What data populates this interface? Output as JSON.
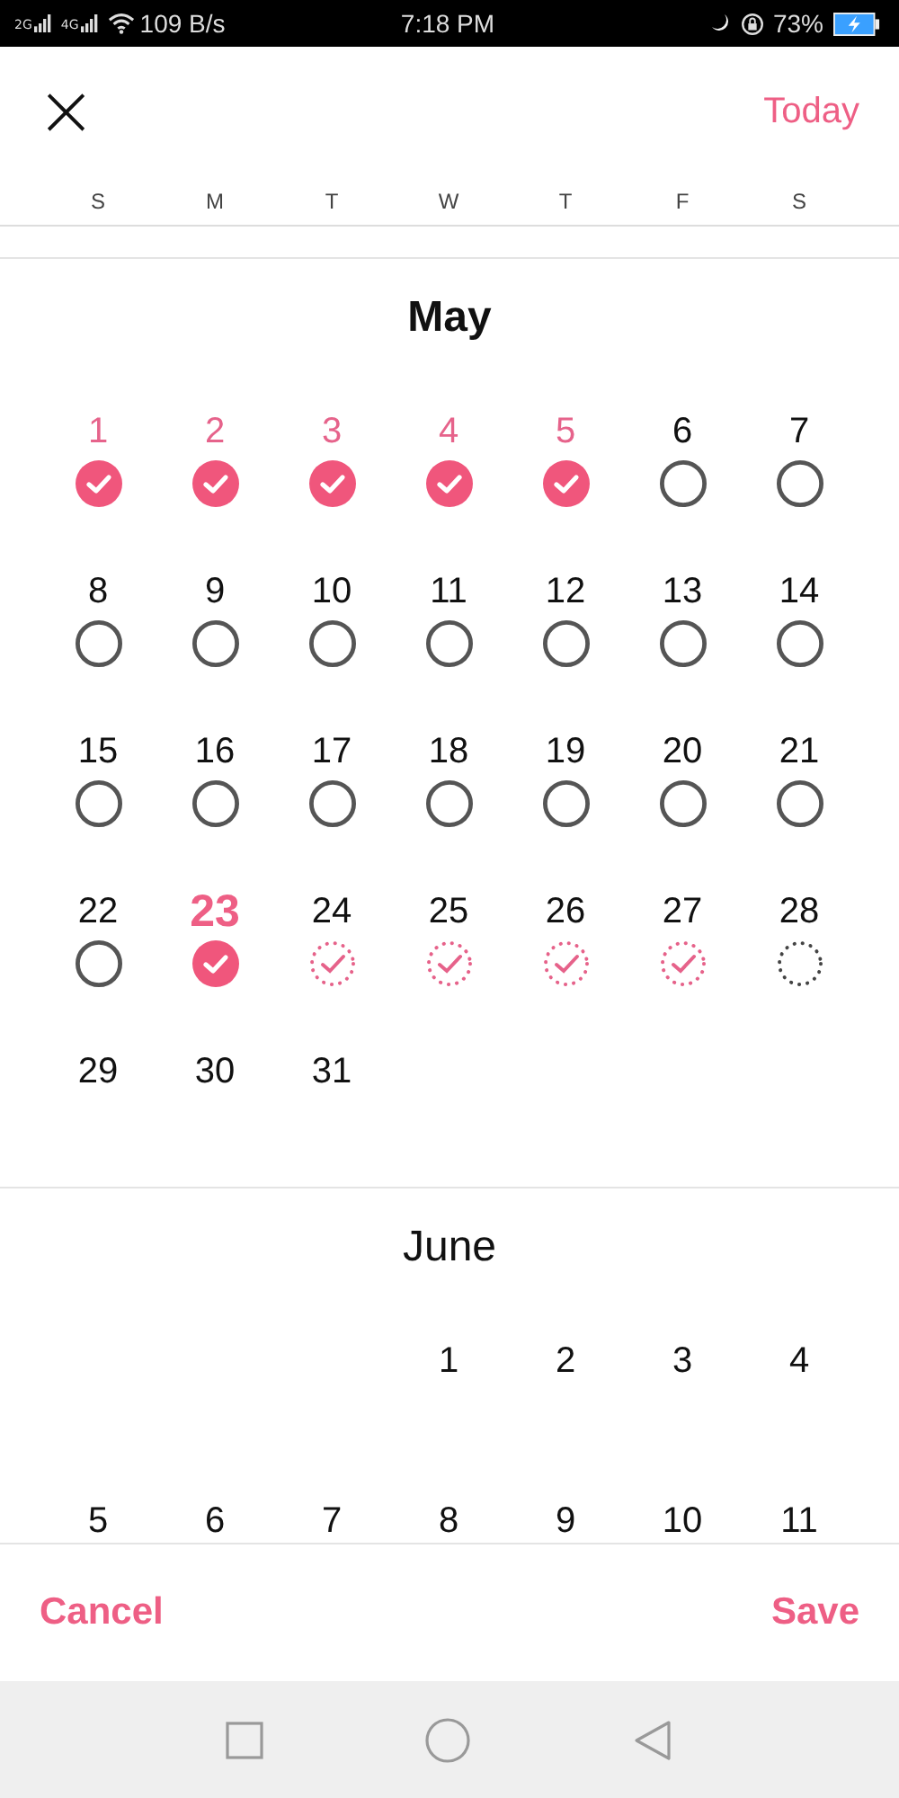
{
  "status_bar": {
    "network_1": "2G",
    "network_2": "4G",
    "speed": "109 B/s",
    "time": "7:18 PM",
    "battery": "73%"
  },
  "header": {
    "close": "×",
    "today": "Today"
  },
  "weekdays": [
    "S",
    "M",
    "T",
    "W",
    "T",
    "F",
    "S"
  ],
  "months": [
    {
      "title": "May",
      "bold": true,
      "days": [
        {
          "label": "1",
          "kind": "checked",
          "today": false
        },
        {
          "label": "2",
          "kind": "checked",
          "today": false
        },
        {
          "label": "3",
          "kind": "checked",
          "today": false
        },
        {
          "label": "4",
          "kind": "checked",
          "today": false
        },
        {
          "label": "5",
          "kind": "checked",
          "today": false
        },
        {
          "label": "6",
          "kind": "open",
          "today": false
        },
        {
          "label": "7",
          "kind": "open",
          "today": false
        },
        {
          "label": "8",
          "kind": "open",
          "today": false
        },
        {
          "label": "9",
          "kind": "open",
          "today": false
        },
        {
          "label": "10",
          "kind": "open",
          "today": false
        },
        {
          "label": "11",
          "kind": "open",
          "today": false
        },
        {
          "label": "12",
          "kind": "open",
          "today": false
        },
        {
          "label": "13",
          "kind": "open",
          "today": false
        },
        {
          "label": "14",
          "kind": "open",
          "today": false
        },
        {
          "label": "15",
          "kind": "open",
          "today": false
        },
        {
          "label": "16",
          "kind": "open",
          "today": false
        },
        {
          "label": "17",
          "kind": "open",
          "today": false
        },
        {
          "label": "18",
          "kind": "open",
          "today": false
        },
        {
          "label": "19",
          "kind": "open",
          "today": false
        },
        {
          "label": "20",
          "kind": "open",
          "today": false
        },
        {
          "label": "21",
          "kind": "open",
          "today": false
        },
        {
          "label": "22",
          "kind": "open",
          "today": false
        },
        {
          "label": "23",
          "kind": "checked",
          "today": true
        },
        {
          "label": "24",
          "kind": "planned",
          "today": false
        },
        {
          "label": "25",
          "kind": "planned",
          "today": false
        },
        {
          "label": "26",
          "kind": "planned",
          "today": false
        },
        {
          "label": "27",
          "kind": "planned",
          "today": false
        },
        {
          "label": "28",
          "kind": "dotted",
          "today": false
        },
        {
          "label": "29",
          "kind": "none",
          "today": false
        },
        {
          "label": "30",
          "kind": "none",
          "today": false
        },
        {
          "label": "31",
          "kind": "none",
          "today": false
        }
      ]
    },
    {
      "title": "June",
      "bold": false,
      "days": [
        {
          "kind": "blank"
        },
        {
          "kind": "blank"
        },
        {
          "kind": "blank"
        },
        {
          "label": "1",
          "kind": "none",
          "today": false
        },
        {
          "label": "2",
          "kind": "none",
          "today": false
        },
        {
          "label": "3",
          "kind": "none",
          "today": false
        },
        {
          "label": "4",
          "kind": "none",
          "today": false
        },
        {
          "label": "5",
          "kind": "none",
          "today": false
        },
        {
          "label": "6",
          "kind": "none",
          "today": false
        },
        {
          "label": "7",
          "kind": "none",
          "today": false
        },
        {
          "label": "8",
          "kind": "none",
          "today": false
        },
        {
          "label": "9",
          "kind": "none",
          "today": false
        },
        {
          "label": "10",
          "kind": "none",
          "today": false
        },
        {
          "label": "11",
          "kind": "none",
          "today": false
        }
      ]
    }
  ],
  "footer": {
    "cancel": "Cancel",
    "save": "Save"
  }
}
